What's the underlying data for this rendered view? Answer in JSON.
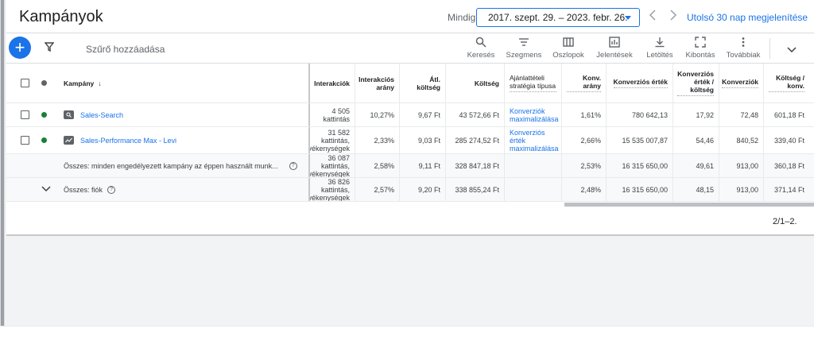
{
  "header": {
    "title": "Kampányok",
    "date_label": "Mindig",
    "date_range": "2017. szept. 29. – 2023. febr. 26.",
    "prev_icon": "chevron-left-icon",
    "next_icon": "chevron-right-icon",
    "last30_label": "Utolsó 30 nap megjelenítése"
  },
  "toolbar": {
    "add_label": "+",
    "filter_label": "Szűrő hozzáadása",
    "tools": [
      {
        "label": "Keresés",
        "icon": "search-icon"
      },
      {
        "label": "Szegmens",
        "icon": "segment-icon"
      },
      {
        "label": "Oszlopok",
        "icon": "columns-icon"
      },
      {
        "label": "Jelentések",
        "icon": "reports-icon"
      },
      {
        "label": "Letöltés",
        "icon": "download-icon"
      },
      {
        "label": "Kibontás",
        "icon": "expand-icon"
      },
      {
        "label": "Továbbiak",
        "icon": "more-vert-icon"
      }
    ]
  },
  "table": {
    "headers": {
      "campaign": "Kampány",
      "interactions": "Interakciók",
      "interaction_rate": "Interakciós arány",
      "avg_cost": "Átl. költség",
      "cost": "Költség",
      "bid_strategy": "Ajánlattételi stratégia típusa",
      "conv_rate": "Konv. arány",
      "conv_value": "Konverziós érték",
      "conv_value_per_cost": "Konverziós érték / költség",
      "conversions": "Konverziók",
      "cost_per_conv": "Költség / konv."
    },
    "rows": [
      {
        "name": "Sales-Search",
        "status_color": "#188038",
        "interactions": "4 505",
        "interactions_unit": "kattintás",
        "interaction_rate": "10,27%",
        "avg_cost": "9,67 Ft",
        "cost": "43 572,66 Ft",
        "bid_strategy": "Konverziók maximalizálása",
        "conv_rate": "1,61%",
        "conv_value": "780 642,13",
        "conv_value_per_cost": "17,92",
        "conversions": "72,48",
        "cost_per_conv": "601,18 Ft"
      },
      {
        "name": "Sales-Performance Max - Levi",
        "status_color": "#188038",
        "interactions": "31 582",
        "interactions_unit": "kattintás,",
        "interactions_unit2": "evékenységek",
        "interaction_rate": "2,33%",
        "avg_cost": "9,03 Ft",
        "cost": "285 274,52 Ft",
        "bid_strategy": "Konverziós érték maximalizálása",
        "conv_rate": "2,66%",
        "conv_value": "15 535 007,87",
        "conv_value_per_cost": "54,46",
        "conversions": "840,52",
        "cost_per_conv": "339,40 Ft"
      }
    ],
    "totals": [
      {
        "name": "Összes: minden engedélyezett kampány az éppen használt munk...",
        "interactions": "36 087",
        "interactions_unit": "kattintás,",
        "interactions_unit2": "evékenységek",
        "interaction_rate": "2,58%",
        "avg_cost": "9,11 Ft",
        "cost": "328 847,18 Ft",
        "conv_rate": "2,53%",
        "conv_value": "16 315 650,00",
        "conv_value_per_cost": "49,61",
        "conversions": "913,00",
        "cost_per_conv": "360,18 Ft"
      },
      {
        "name": "Összes: fiók",
        "interactions": "36 826",
        "interactions_unit": "kattintás,",
        "interactions_unit2": "evékenységek",
        "interaction_rate": "2,57%",
        "avg_cost": "9,20 Ft",
        "cost": "338 855,24 Ft",
        "conv_rate": "2,48%",
        "conv_value": "16 315 650,00",
        "conv_value_per_cost": "48,15",
        "conversions": "913,00",
        "cost_per_conv": "371,14 Ft"
      }
    ],
    "pager": "2/1–2."
  },
  "colors": {
    "accent": "#1a73e8",
    "status_enabled": "#188038",
    "status_header": "#5f6368"
  }
}
